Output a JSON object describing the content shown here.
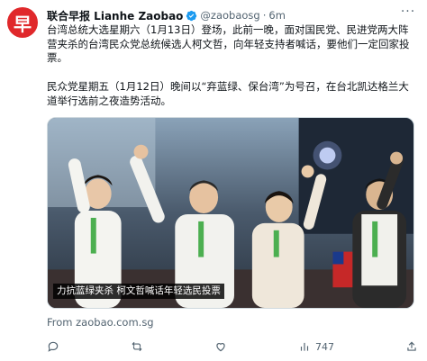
{
  "tweet": {
    "display_name": "联合早报 Lianhe Zaobao",
    "handle": "@zaobaosg",
    "separator": "·",
    "time": "6m",
    "avatar_char": "早",
    "paragraph1": "台湾总统大选星期六（1月13日）登场，此前一晚，面对国民党、民进党两大阵营夹杀的台湾民众党总统候选人柯文哲，向年轻支持者喊话，要他们一定回家投票。",
    "paragraph2": "民众党星期五（1月12日）晚间以“弃蓝绿、保台湾”为号召，在台北凯达格兰大道举行选前之夜造势活动。",
    "image_caption": "力抗蓝绿夹杀 柯文哲喊话年轻选民投票",
    "source": "From zaobao.com.sg",
    "views": "747"
  },
  "icons": {
    "verified": "verified-badge-icon",
    "more": "more-options-icon",
    "reply": "reply-icon",
    "retweet": "retweet-icon",
    "like": "like-icon",
    "views": "views-icon",
    "share": "share-icon"
  },
  "colors": {
    "brand": "#e0282b",
    "verified": "#1d9bf0",
    "secondary_text": "#536471"
  }
}
